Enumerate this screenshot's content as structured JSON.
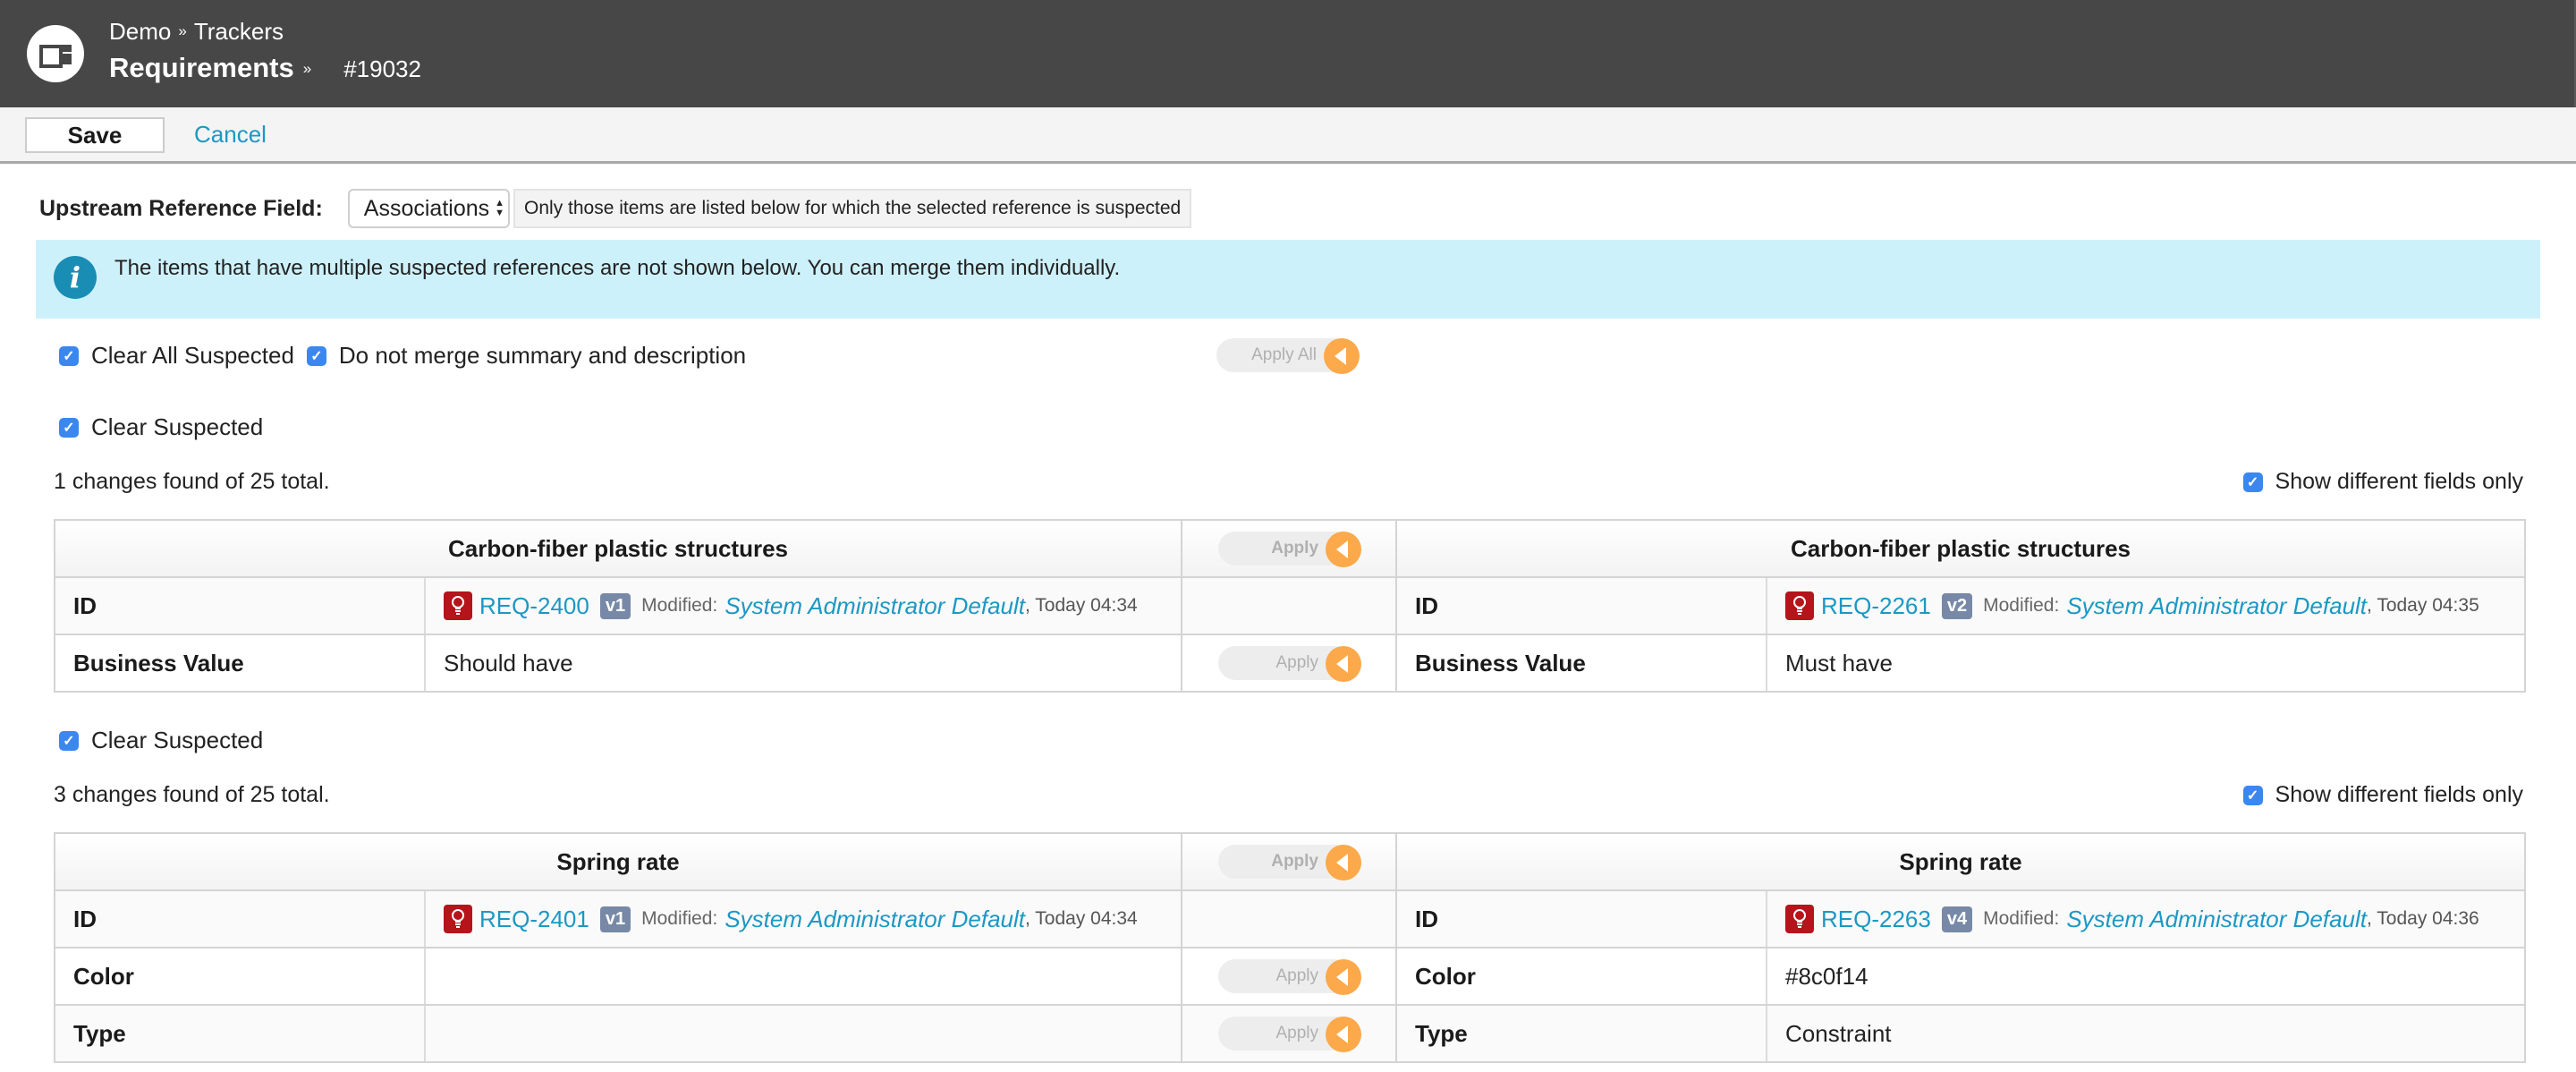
{
  "header": {
    "breadcrumb": [
      "Demo",
      "Trackers"
    ],
    "breadcrumb_sep": "»",
    "title": "Requirements",
    "item_number": "#19032"
  },
  "actions": {
    "save_label": "Save",
    "cancel_label": "Cancel"
  },
  "upstream": {
    "label": "Upstream Reference Field:",
    "selected": "Associations",
    "hint": "Only those items are listed below for which the selected reference is suspected"
  },
  "info": {
    "icon": "info-icon",
    "text": "The items that have multiple suspected references are not shown below. You can merge them individually."
  },
  "global_options": {
    "clear_all_suspected": {
      "label": "Clear All Suspected",
      "checked": true
    },
    "do_not_merge": {
      "label": "Do not merge summary and description",
      "checked": true
    },
    "apply_all_label": "Apply All"
  },
  "colors": {
    "header_bg": "#474747",
    "link": "#1b98c4",
    "info_bg": "#cdf1fb",
    "apply_arrow": "#fba94a",
    "checkbox": "#3b87f0",
    "req_icon": "#b5141b",
    "version_badge": "#7789a6"
  },
  "sections": [
    {
      "clear_suspected": {
        "label": "Clear Suspected",
        "checked": true
      },
      "count_text": "1 changes found of 25 total.",
      "show_diff": {
        "label": "Show different fields only",
        "checked": true
      },
      "left_title": "Carbon-fiber plastic structures",
      "right_title": "Carbon-fiber plastic structures",
      "apply_label": "Apply",
      "id_row": {
        "label": "ID",
        "left": {
          "req": "REQ-2400",
          "version": "v1",
          "modified_label": "Modified:",
          "user": "System Administrator Default",
          "time": ", Today 04:34"
        },
        "right": {
          "req": "REQ-2261",
          "version": "v2",
          "modified_label": "Modified:",
          "user": "System Administrator Default",
          "time": ", Today 04:35"
        }
      },
      "fields": [
        {
          "label": "Business Value",
          "left": "Should have",
          "right": "Must have",
          "apply_label": "Apply"
        }
      ]
    },
    {
      "clear_suspected": {
        "label": "Clear Suspected",
        "checked": true
      },
      "count_text": "3 changes found of 25 total.",
      "show_diff": {
        "label": "Show different fields only",
        "checked": true
      },
      "left_title": "Spring rate",
      "right_title": "Spring rate",
      "apply_label": "Apply",
      "id_row": {
        "label": "ID",
        "left": {
          "req": "REQ-2401",
          "version": "v1",
          "modified_label": "Modified:",
          "user": "System Administrator Default",
          "time": ", Today 04:34"
        },
        "right": {
          "req": "REQ-2263",
          "version": "v4",
          "modified_label": "Modified:",
          "user": "System Administrator Default",
          "time": ", Today 04:36"
        }
      },
      "fields": [
        {
          "label": "Color",
          "left": "",
          "right": "#8c0f14",
          "apply_label": "Apply"
        },
        {
          "label": "Type",
          "left": "",
          "right": "Constraint",
          "apply_label": "Apply"
        }
      ]
    }
  ]
}
